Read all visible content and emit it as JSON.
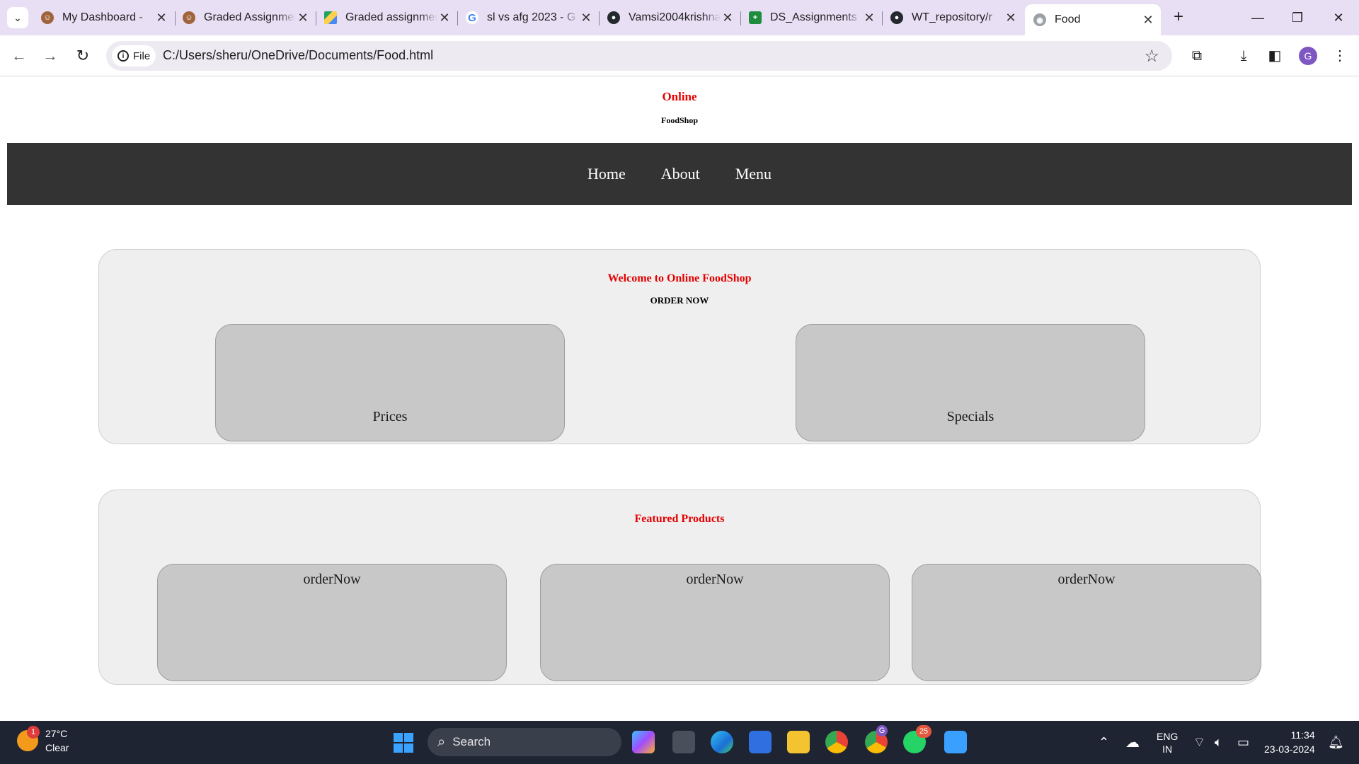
{
  "browser": {
    "tabs": [
      {
        "title": "My Dashboard -",
        "favicon": "moodle-icon",
        "active": false
      },
      {
        "title": "Graded Assignment",
        "favicon": "moodle-icon",
        "active": false
      },
      {
        "title": "Graded assignment",
        "favicon": "google-drive-icon",
        "active": false
      },
      {
        "title": "sl vs afg 2023 - G",
        "favicon": "google-icon",
        "active": false
      },
      {
        "title": "Vamsi2004krishna",
        "favicon": "github-icon",
        "active": false
      },
      {
        "title": "DS_Assignments",
        "favicon": "google-sheets-icon",
        "active": false
      },
      {
        "title": "WT_repository/r",
        "favicon": "github-icon",
        "active": false
      },
      {
        "title": "Food",
        "favicon": "globe-icon",
        "active": true
      }
    ],
    "address": {
      "chip_label": "File",
      "url": "C:/Users/sheru/OneDrive/Documents/Food.html"
    },
    "profile_initial": "G"
  },
  "site": {
    "title": "Online",
    "subtitle": "FoodShop",
    "nav": [
      "Home",
      "About",
      "Menu"
    ],
    "welcome": {
      "heading": "Welcome to Online FoodShop",
      "cta": "ORDER NOW",
      "cards": [
        "Prices",
        "Specials"
      ]
    },
    "featured": {
      "heading": "Featured Products",
      "cards": [
        "orderNow",
        "orderNow",
        "orderNow"
      ]
    }
  },
  "taskbar": {
    "weather": {
      "temp": "27°C",
      "condition": "Clear",
      "badge": "1"
    },
    "search_label": "Search",
    "whatsapp_badge": "25",
    "chrome_profile_badge": "G",
    "lang_top": "ENG",
    "lang_bottom": "IN",
    "time": "11:34",
    "date": "23-03-2024"
  },
  "colors": {
    "brand_red": "#e60000",
    "nav_bg": "#333333",
    "panel_bg": "#efefef",
    "card_bg": "#c8c8c8",
    "tabstrip_bg": "#e9dff5",
    "taskbar_bg": "#1f2433"
  }
}
